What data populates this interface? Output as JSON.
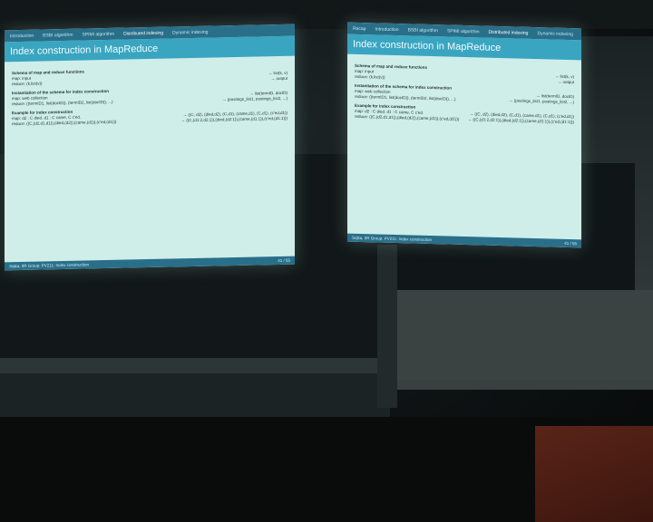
{
  "left_slide": {
    "nav": [
      "Introduction",
      "BSBI algorithm",
      "SPIMI algorithm",
      "Distributed indexing",
      "Dynamic indexing"
    ],
    "active_nav": 3,
    "title": "Index construction in MapReduce",
    "sections": [
      {
        "heading": "Schema of map and reduce functions",
        "rows": [
          [
            "map:    input",
            "→ list(k, v)"
          ],
          [
            "reduce: (k,list(v))",
            "→ output"
          ]
        ]
      },
      {
        "heading": "Instantiation of the schema for index construction",
        "rows": [
          [
            "map:    web collection",
            "→ list(termID, docID)"
          ],
          [
            "reduce: ((termID1, list(docID)), (termID2, list(docID)), ...)",
            "→ (postings_list1, postings_list2, ...)"
          ]
        ]
      },
      {
        "heading": "Example for index construction",
        "rows": [
          [
            "map:    d2 : C died. d1 : C came, C c'ed.",
            "→ ((C, d2), (died,d2), (C,d1), (came,d1), (C,d1), (c'ed,d1))"
          ],
          [
            "reduce: ((C,(d2,d1,d1)),(died,(d2)),(came,(d1)),(c'ed,(d1)))",
            "→ ((C,(d1:2,d2:1)),(died,(d2:1)),(came,(d1:1)),(c'ed,(d1:1)))"
          ]
        ]
      }
    ],
    "footer_left": "Sojka, IIR Group: PV211: Index construction",
    "footer_right": "41 / 55"
  },
  "right_slide": {
    "nav": [
      "Recap",
      "Introduction",
      "BSBI algorithm",
      "SPIMI algorithm",
      "Distributed indexing",
      "Dynamic indexing"
    ],
    "active_nav": 4,
    "title": "Index construction in MapReduce",
    "sections": [
      {
        "heading": "Schema of map and reduce functions",
        "rows": [
          [
            "map:    input",
            "→ list(k, v)"
          ],
          [
            "reduce: (k,list(v))",
            "→ output"
          ]
        ]
      },
      {
        "heading": "Instantiation of the schema for index construction",
        "rows": [
          [
            "map:    web collection",
            "→ list(termID, docID)"
          ],
          [
            "reduce: ((termID1, list(docID)), (termID2, list(docID)), ...)",
            "→ (postings_list1, postings_list2, ...)"
          ]
        ]
      },
      {
        "heading": "Example for index construction",
        "rows": [
          [
            "map:    d2 : C died. d1 : C came, C c'ed.",
            "→ ((C, d2), (died,d2), (C,d1), (came,d1), (C,d1), (c'ed,d1))"
          ],
          [
            "reduce: ((C,(d2,d1,d1)),(died,(d2)),(came,(d1)),(c'ed,(d1)))",
            "→ ((C,(d1:2,d2:1)),(died,(d2:1)),(came,(d1:1)),(c'ed,(d1:1)))"
          ]
        ]
      }
    ],
    "footer_left": "Sojka, IIR Group: PV211: Index construction",
    "footer_right": "41 / 55"
  }
}
